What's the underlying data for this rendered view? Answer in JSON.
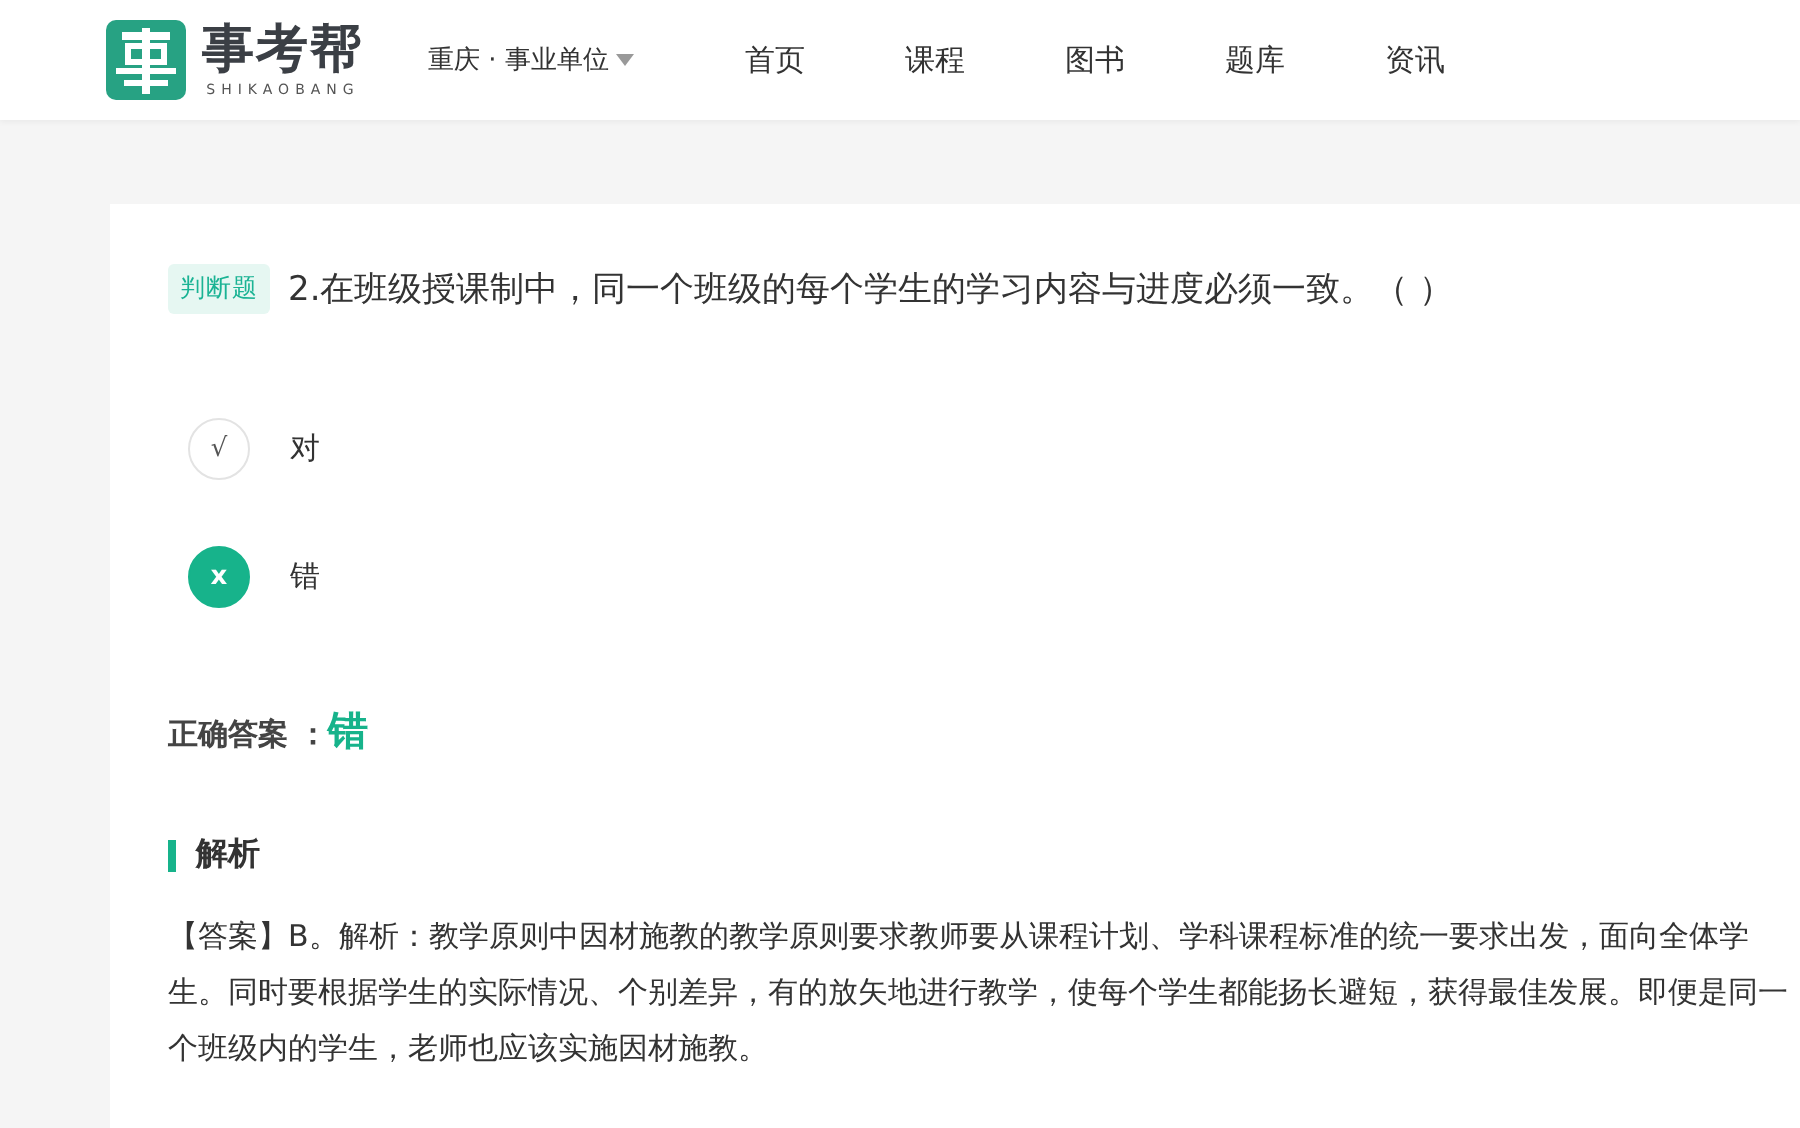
{
  "header": {
    "brand": "事考帮",
    "brand_sub": "SHIKAOBANG",
    "region": "重庆 · 事业单位",
    "nav": [
      {
        "label": "首页"
      },
      {
        "label": "课程"
      },
      {
        "label": "图书"
      },
      {
        "label": "题库"
      },
      {
        "label": "资讯"
      }
    ]
  },
  "question": {
    "tag": "判断题",
    "text": "2.在班级授课制中，同一个班级的每个学生的学习内容与进度必须一致。（    ）",
    "options": [
      {
        "mark": "√",
        "label": "对",
        "selected": false
      },
      {
        "mark": "x",
        "label": "错",
        "selected": true
      }
    ],
    "answer_label": "正确答案 ：",
    "answer": "错",
    "analysis_title": "解析",
    "analysis": "【答案】B。解析：教学原则中因材施教的教学原则要求教师要从课程计划、学科课程标准的统一要求出发，面向全体学生。同时要根据学生的实际情况、个别差异，有的放矢地进行教学，使每个学生都能扬长避短，获得最佳发展。即便是同一个班级内的学生，老师也应该实施因材施教。"
  }
}
